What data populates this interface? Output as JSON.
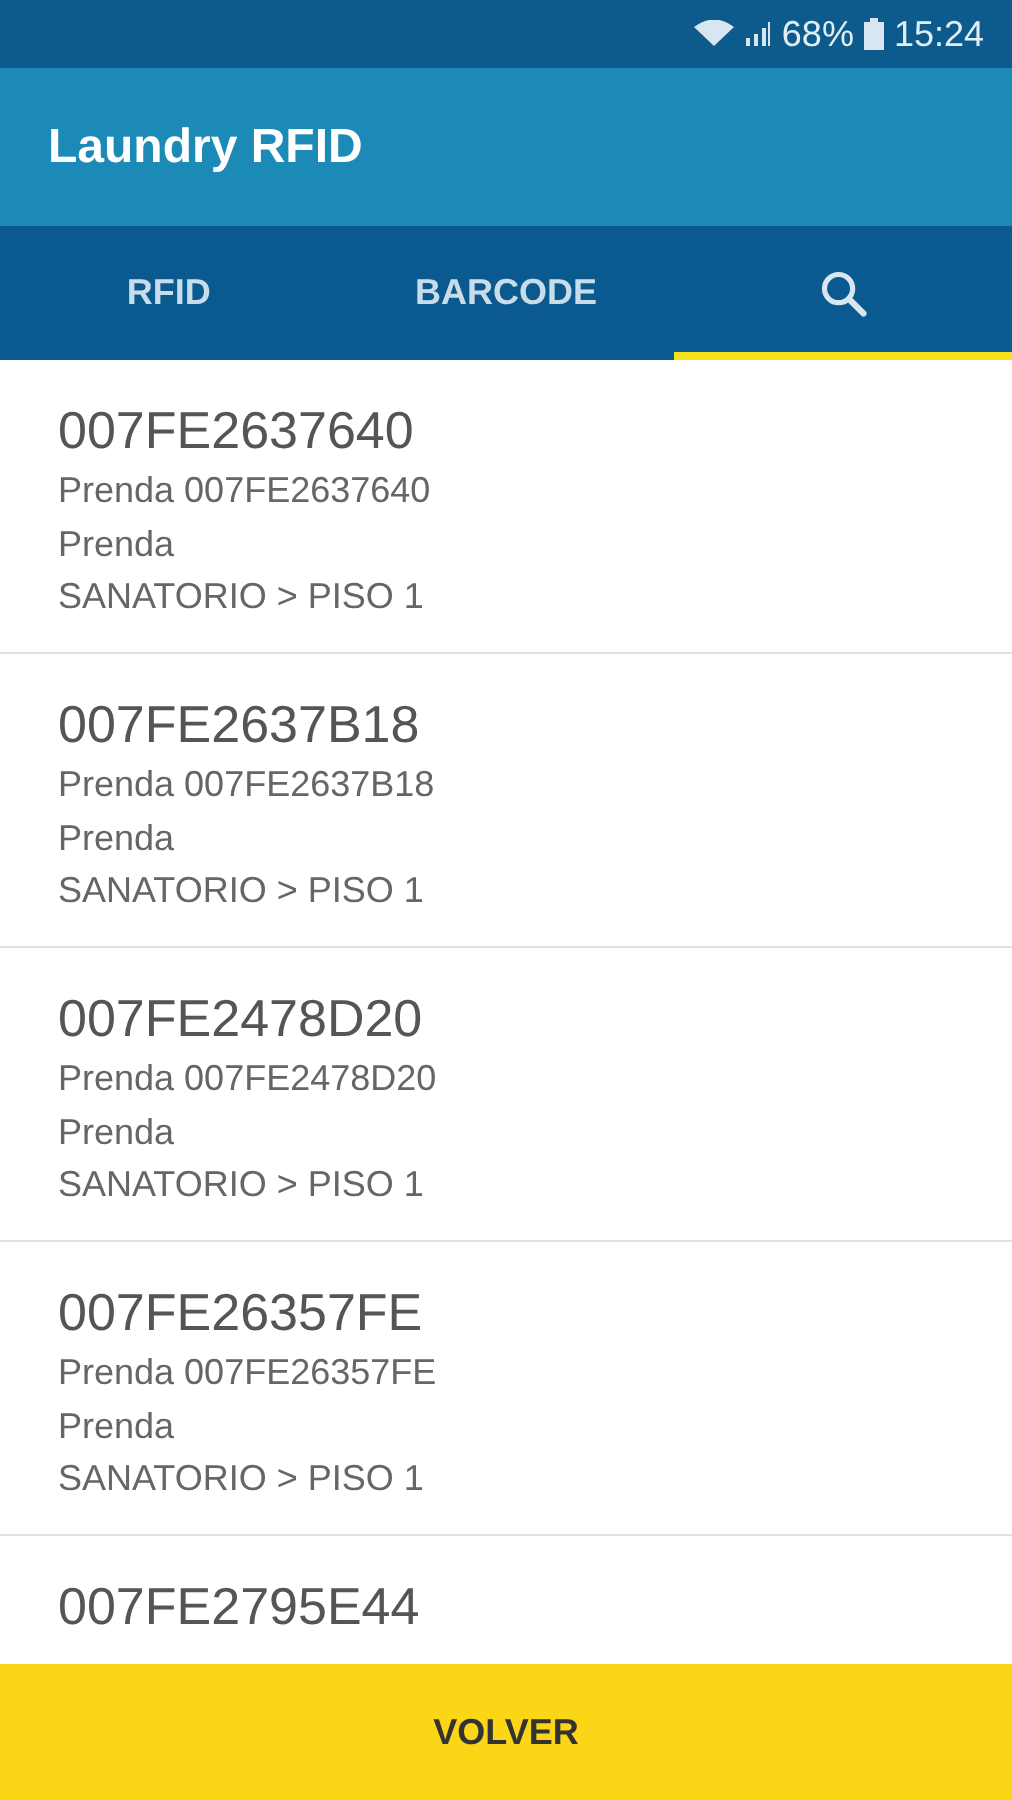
{
  "status_bar": {
    "battery": "68%",
    "time": "15:24"
  },
  "app_bar": {
    "title": "Laundry RFID"
  },
  "tabs": [
    {
      "kind": "text",
      "label": "RFID",
      "selected": false
    },
    {
      "kind": "text",
      "label": "BARCODE",
      "selected": false
    },
    {
      "kind": "search",
      "selected": true
    }
  ],
  "items": [
    {
      "code": "007FE2637640",
      "lines": [
        "Prenda 007FE2637640",
        "Prenda",
        "SANATORIO > PISO 1"
      ]
    },
    {
      "code": "007FE2637B18",
      "lines": [
        "Prenda 007FE2637B18",
        "Prenda",
        "SANATORIO > PISO 1"
      ]
    },
    {
      "code": "007FE2478D20",
      "lines": [
        "Prenda 007FE2478D20",
        "Prenda",
        "SANATORIO > PISO 1"
      ]
    },
    {
      "code": "007FE26357FE",
      "lines": [
        "Prenda 007FE26357FE",
        "Prenda",
        "SANATORIO > PISO 1"
      ]
    },
    {
      "code": "007FE2795E44"
    }
  ],
  "bottom_button": {
    "label": "VOLVER"
  }
}
